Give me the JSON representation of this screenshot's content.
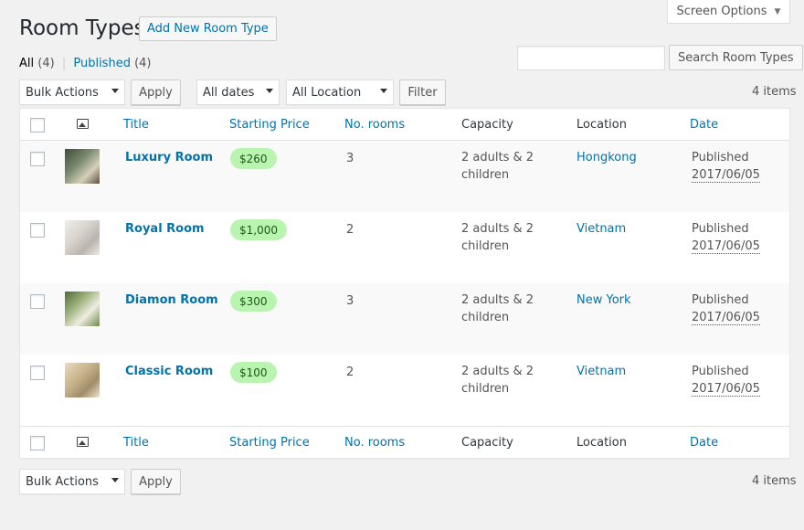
{
  "screen_options": {
    "label": "Screen Options"
  },
  "page": {
    "title": "Room Types",
    "add_new": "Add New Room Type"
  },
  "filters": {
    "all_label": "All",
    "all_count": "(4)",
    "published_label": "Published",
    "published_count": "(4)",
    "separator": "|"
  },
  "search": {
    "button": "Search Room Types",
    "value": ""
  },
  "toolbar_top": {
    "bulk_actions": "Bulk Actions",
    "apply": "Apply",
    "dates": "All dates",
    "location": "All Location",
    "filter": "Filter",
    "items": "4 items"
  },
  "toolbar_bottom": {
    "bulk_actions": "Bulk Actions",
    "apply": "Apply",
    "items": "4 items"
  },
  "columns": {
    "title": "Title",
    "price": "Starting Price",
    "rooms": "No. rooms",
    "capacity": "Capacity",
    "location": "Location",
    "date": "Date"
  },
  "rows": [
    {
      "title": "Luxury Room",
      "price": "$260",
      "rooms": "3",
      "capacity": "2 adults & 2 children",
      "location": "Hongkong",
      "status": "Published",
      "date": "2017/06/05",
      "thumb_colors": [
        "#5a6b5a",
        "#c9c4b0"
      ]
    },
    {
      "title": "Royal Room",
      "price": "$1,000",
      "rooms": "2",
      "capacity": "2 adults & 2 children",
      "location": "Vietnam",
      "status": "Published",
      "date": "2017/06/05",
      "thumb_colors": [
        "#e4e2de",
        "#b9b4ad"
      ]
    },
    {
      "title": "Diamon Room",
      "price": "$300",
      "rooms": "3",
      "capacity": "2 adults & 2 children",
      "location": "New York",
      "status": "Published",
      "date": "2017/06/05",
      "thumb_colors": [
        "#6e8a4e",
        "#e8e5d8"
      ]
    },
    {
      "title": "Classic Room",
      "price": "$100",
      "rooms": "2",
      "capacity": "2 adults & 2 children",
      "location": "Vietnam",
      "status": "Published",
      "date": "2017/06/05",
      "thumb_colors": [
        "#d8c9a8",
        "#a08c6a"
      ]
    }
  ]
}
